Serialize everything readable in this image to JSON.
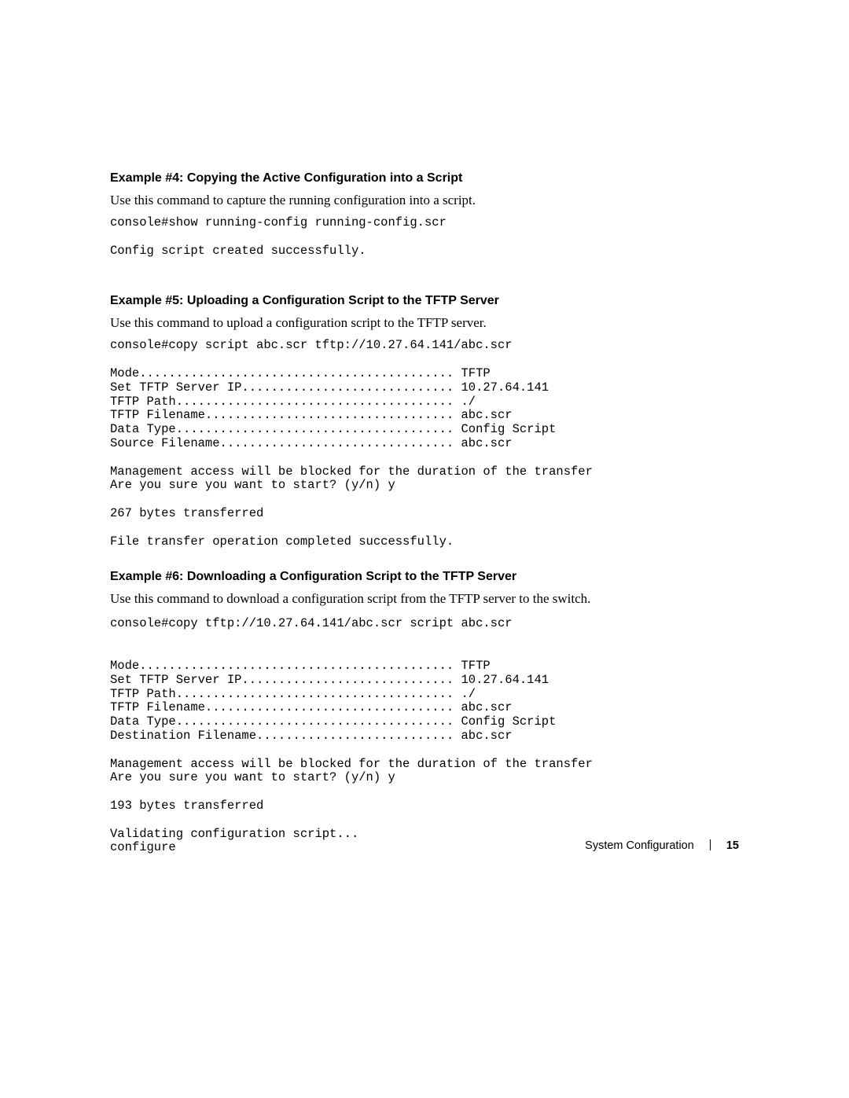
{
  "sections": {
    "ex4": {
      "heading": "Example #4: Copying the Active Configuration into a Script",
      "body": "Use this command to capture the running configuration into a script.",
      "code": "console#show running-config running-config.scr\n\nConfig script created successfully."
    },
    "ex5": {
      "heading": "Example #5: Uploading a Configuration Script to the TFTP Server",
      "body": "Use this command to upload a configuration script to the TFTP server.",
      "code": "console#copy script abc.scr tftp://10.27.64.141/abc.scr\n\nMode........................................... TFTP\nSet TFTP Server IP............................. 10.27.64.141\nTFTP Path...................................... ./\nTFTP Filename.................................. abc.scr\nData Type...................................... Config Script\nSource Filename................................ abc.scr\n\nManagement access will be blocked for the duration of the transfer\nAre you sure you want to start? (y/n) y\n\n267 bytes transferred\n\nFile transfer operation completed successfully."
    },
    "ex6": {
      "heading": "Example #6: Downloading a Configuration Script to the TFTP Server",
      "body": "Use this command to download a configuration script from the TFTP server to the switch.",
      "code": "console#copy tftp://10.27.64.141/abc.scr script abc.scr\n\n\nMode........................................... TFTP\nSet TFTP Server IP............................. 10.27.64.141\nTFTP Path...................................... ./\nTFTP Filename.................................. abc.scr\nData Type...................................... Config Script\nDestination Filename........................... abc.scr\n\nManagement access will be blocked for the duration of the transfer\nAre you sure you want to start? (y/n) y\n\n193 bytes transferred\n\nValidating configuration script...\nconfigure"
    }
  },
  "footer": {
    "section_title": "System Configuration",
    "page_number": "15"
  }
}
